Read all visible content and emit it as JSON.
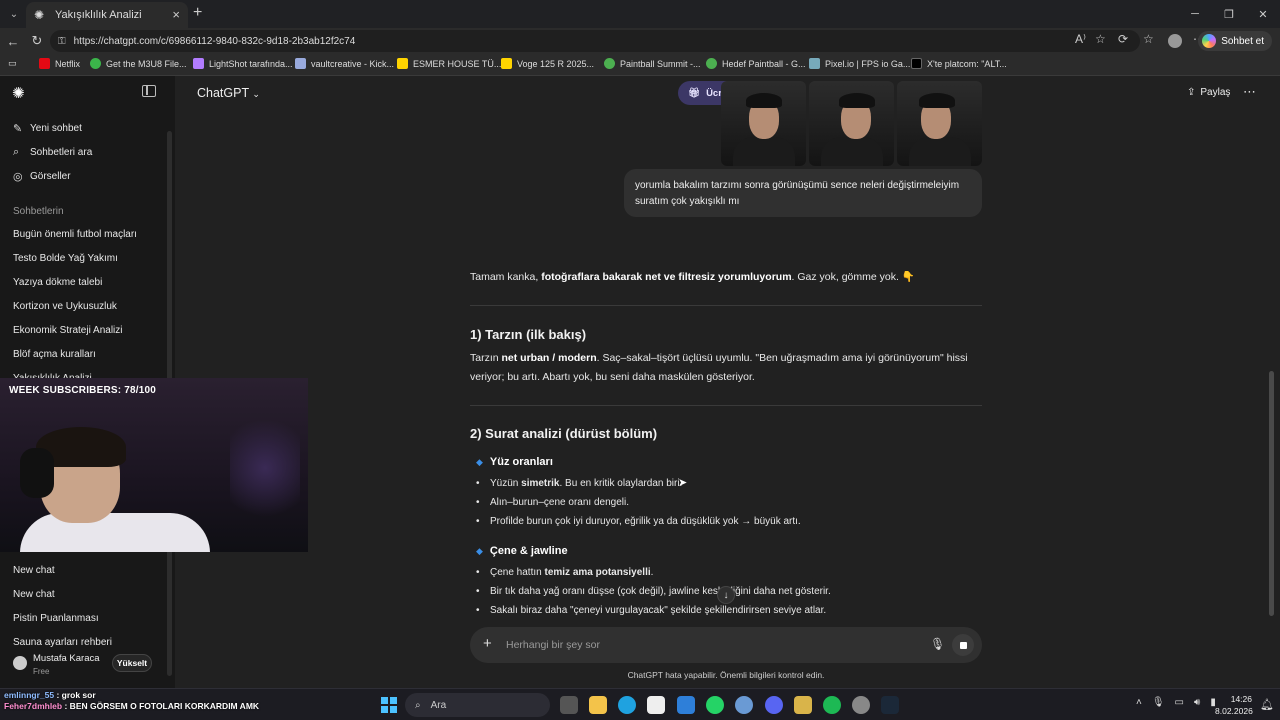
{
  "browser": {
    "tab_title": "Yakışıklılık Analizi",
    "url": "https://chatgpt.com/c/69866112-9840-832c-9d18-2b3ab12f2c74",
    "sohbet_et": "Sohbet et",
    "bookmarks": [
      "Netflix",
      "Get the M3U8 File...",
      "LightShot tarafında...",
      "vaultcreative - Kick...",
      "ESMER HOUSE TÜ...",
      "Voge 125 R 2025...",
      "Paintball Summit -...",
      "Hedef Paintball - G...",
      "Pixel.io | FPS io Ga...",
      "X'te platcom: \"ALT..."
    ]
  },
  "sidebar": {
    "new_chat": "Yeni sohbet",
    "search": "Sohbetleri ara",
    "images": "Görseller",
    "section": "Sohbetlerin",
    "chats": [
      "Bugün önemli futbol maçları",
      "Testo Bolde Yağ Yakımı",
      "Yazıya dökme talebi",
      "Kortizon ve Uykusuzluk",
      "Ekonomik Strateji Analizi",
      "Blöf açma kuralları",
      "Yakışıklılık Analizi"
    ],
    "chats_bottom": [
      "New chat",
      "New chat",
      "Pistin Puanlanması",
      "Sauna ayarları rehberi"
    ],
    "user_name": "Mustafa Karaca",
    "user_plan": "Free",
    "upgrade": "Yükselt"
  },
  "stream": {
    "overlay": "WEEK SUBSCRIBERS: 78/100"
  },
  "header": {
    "model": "ChatGPT",
    "offer": "Ücretsiz teklif",
    "share": "Paylaş"
  },
  "conversation": {
    "user_message": "yorumla bakalım tarzımı sonra görünüşümü sence neleri değiştirmeleiyim suratım çok yakışıklı mı",
    "intro_a": "Tamam kanka, ",
    "intro_b": "fotoğraflara bakarak net ve filtresiz yorumluyorum",
    "intro_c": ". Gaz yok, gömme yok. 👇",
    "h1": "1) Tarzın (ilk bakış)",
    "p1_a": "Tarzın ",
    "p1_b": "net urban / modern",
    "p1_c": ". Saç–sakal–tişört üçlüsü uyumlu. \"Ben uğraşmadım ama iyi görünüyorum\" hissi veriyor; bu artı. Abartı yok, bu seni daha maskülen gösteriyor.",
    "h2": "2) Surat analizi (dürüst bölüm)",
    "sub1": "Yüz oranları",
    "b1_a": "Yüzün ",
    "b1_b": "simetrik",
    "b1_c": ". Bu en kritik olaylardan biri.",
    "b2": "Alın–burun–çene oranı dengeli.",
    "b3": "Profilde burun çok iyi duruyor, eğrilik ya da düşüklük yok → büyük artı.",
    "sub2": "Çene & jawline",
    "b4_a": "Çene hattın ",
    "b4_b": "temiz ama potansiyelli",
    "b4_c": ".",
    "b5": "Bir tık daha yağ oranı düşse (çok değil), jawline keskinliğini daha net gösterir.",
    "b6": "Sakalı biraz daha \"çeneyi vurgulayacak\" şekilde şekillendirirsen seviye atlar."
  },
  "composer": {
    "placeholder": "Herhangi bir şey sor",
    "disclaimer": "ChatGPT hata yapabilir. Önemli bilgileri kontrol edin."
  },
  "taskbar": {
    "search": "Ara",
    "time": "14:26",
    "date": "8.02.2026",
    "chat_line1_name": "emlinngr_55",
    "chat_line1_msg": ": grok sor",
    "chat_line2_name": "Feher7dmhleb",
    "chat_line2_msg": ": BEN GÖRSEM O FOTOLARI KORKARDIM AMK"
  }
}
